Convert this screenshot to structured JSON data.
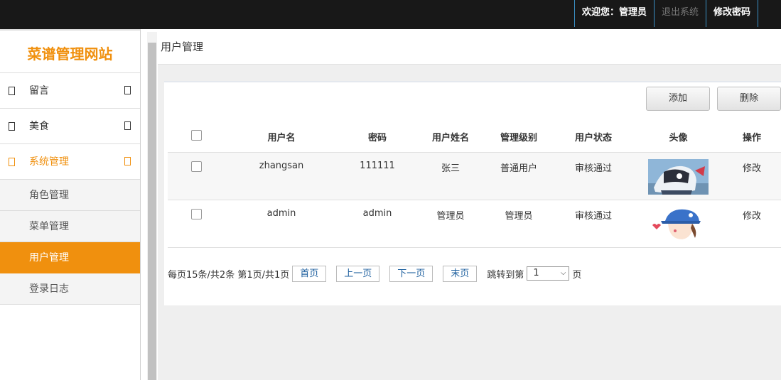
{
  "topnav": {
    "welcome": "欢迎您：管理员",
    "logout": "退出系统",
    "change_password": "修改密码"
  },
  "sidebar": {
    "logo": "菜谱管理网站",
    "menu": [
      {
        "label": "留言"
      },
      {
        "label": "美食"
      },
      {
        "label": "系统管理"
      }
    ],
    "submenu": [
      {
        "label": "角色管理"
      },
      {
        "label": "菜单管理"
      },
      {
        "label": "用户管理"
      },
      {
        "label": "登录日志"
      }
    ]
  },
  "page": {
    "title": "用户管理"
  },
  "toolbar": {
    "add": "添加",
    "delete": "删除"
  },
  "table": {
    "columns": [
      "用户名",
      "密码",
      "用户姓名",
      "管理级别",
      "用户状态",
      "头像",
      "操作"
    ],
    "rows": [
      {
        "username": "zhangsan",
        "password": "111111",
        "name": "张三",
        "level": "普通用户",
        "status": "审核通过",
        "avatar": "helmet-girl-avatar",
        "action": "修改"
      },
      {
        "username": "admin",
        "password": "admin",
        "name": "管理员",
        "level": "管理员",
        "status": "审核通过",
        "avatar": "blue-cap-avatar",
        "action": "修改"
      }
    ]
  },
  "pager": {
    "summary": "每页15条/共2条 第1页/共1页",
    "first": "首页",
    "prev": "上一页",
    "next": "下一页",
    "last": "末页",
    "jump_label": "跳转到第",
    "page_value": "1",
    "page_suffix": "页"
  },
  "colors": {
    "accent": "#f0900e",
    "topbar": "#181818",
    "link": "#1d5f9e"
  }
}
